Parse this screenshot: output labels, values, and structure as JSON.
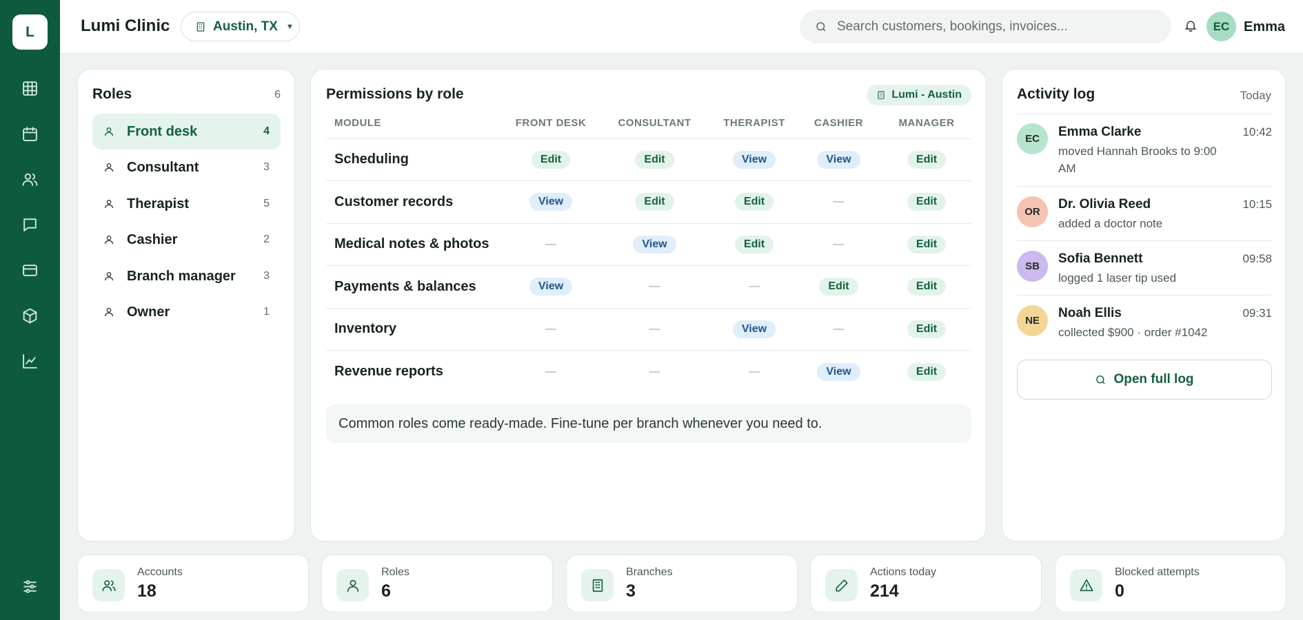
{
  "sidebar": {
    "logo_letter": "L"
  },
  "topbar": {
    "app_title": "Lumi Clinic",
    "branch": "Austin, TX",
    "search_placeholder": "Search customers, bookings, invoices...",
    "avatar_initials": "EC",
    "user_name": "Emma"
  },
  "roles": {
    "title": "Roles",
    "count": "6",
    "items": [
      {
        "label": "Front desk",
        "count": "4"
      },
      {
        "label": "Consultant",
        "count": "3"
      },
      {
        "label": "Therapist",
        "count": "5"
      },
      {
        "label": "Cashier",
        "count": "2"
      },
      {
        "label": "Branch manager",
        "count": "3"
      },
      {
        "label": "Owner",
        "count": "1"
      }
    ]
  },
  "permissions": {
    "title": "Permissions by role",
    "branch_badge": "Lumi - Austin",
    "columns": [
      "MODULE",
      "FRONT DESK",
      "CONSULTANT",
      "THERAPIST",
      "CASHIER",
      "MANAGER"
    ],
    "rows": [
      {
        "module": "Scheduling",
        "values": [
          "Edit",
          "Edit",
          "View",
          "View",
          "Edit"
        ]
      },
      {
        "module": "Customer records",
        "values": [
          "View",
          "Edit",
          "Edit",
          "—",
          "Edit"
        ]
      },
      {
        "module": "Medical notes & photos",
        "values": [
          "—",
          "View",
          "Edit",
          "—",
          "Edit"
        ]
      },
      {
        "module": "Payments & balances",
        "values": [
          "View",
          "—",
          "—",
          "Edit",
          "Edit"
        ]
      },
      {
        "module": "Inventory",
        "values": [
          "—",
          "—",
          "View",
          "—",
          "Edit"
        ]
      },
      {
        "module": "Revenue reports",
        "values": [
          "—",
          "—",
          "—",
          "View",
          "Edit"
        ]
      }
    ],
    "note": "Common roles come ready-made. Fine-tune per branch whenever you need to."
  },
  "activity": {
    "title": "Activity log",
    "period": "Today",
    "items": [
      {
        "initials": "EC",
        "name": "Emma Clarke",
        "desc": "moved Hannah Brooks to 9:00 AM",
        "time": "10:42",
        "color": "#b6e4cc"
      },
      {
        "initials": "OR",
        "name": "Dr. Olivia Reed",
        "desc": "added a doctor note",
        "time": "10:15",
        "color": "#f4c3b2"
      },
      {
        "initials": "SB",
        "name": "Sofia Bennett",
        "desc": "logged 1 laser tip used",
        "time": "09:58",
        "color": "#cdb9ef"
      },
      {
        "initials": "NE",
        "name": "Noah Ellis",
        "desc": "collected $900 · order #1042",
        "time": "09:31",
        "color": "#f3d695"
      }
    ],
    "open_log_label": "Open full log"
  },
  "stats": [
    {
      "label": "Accounts",
      "value": "18",
      "icon": "users-icon"
    },
    {
      "label": "Roles",
      "value": "6",
      "icon": "user-icon"
    },
    {
      "label": "Branches",
      "value": "3",
      "icon": "building-icon"
    },
    {
      "label": "Actions today",
      "value": "214",
      "icon": "pencil-icon"
    },
    {
      "label": "Blocked attempts",
      "value": "0",
      "icon": "alert-triangle-icon"
    }
  ]
}
